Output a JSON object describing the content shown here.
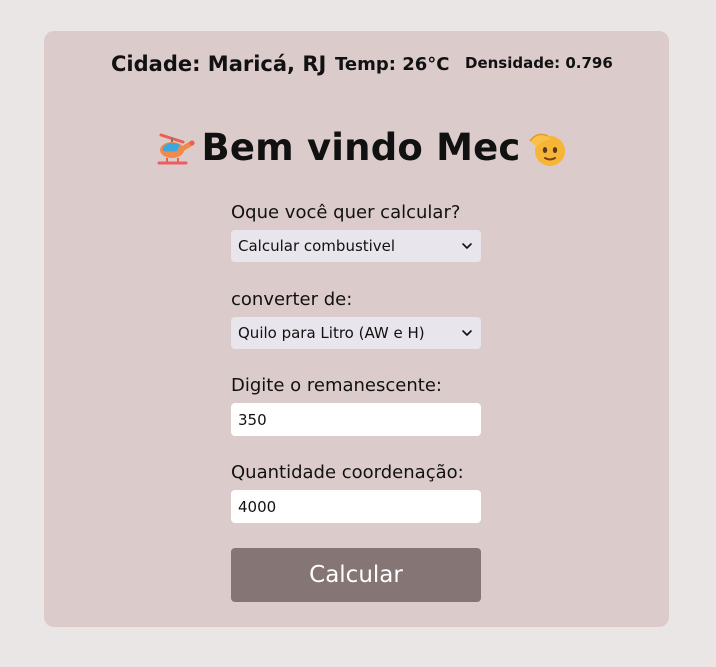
{
  "header": {
    "city": "Cidade: Maricá, RJ",
    "temperature": "Temp: 26°C",
    "density": "Densidade: 0.796"
  },
  "title": {
    "text": "Bem vindo Mec",
    "left_icon": "helicopter-icon",
    "right_icon": "saluting-face-icon"
  },
  "form": {
    "calc_label": "Oque você quer calcular?",
    "calc_select_value": "Calcular combustivel",
    "convert_label": "converter de:",
    "convert_select_value": "Quilo para Litro (AW e H)",
    "remaining_label": "Digite o remanescente:",
    "remaining_value": "350",
    "coordination_label": "Quantidade coordenação:",
    "coordination_value": "4000",
    "submit_label": "Calcular"
  },
  "colors": {
    "page_background": "#ebe6e6",
    "card_background": "#dbcbcb",
    "select_background": "#e8e6ec",
    "input_background": "#ffffff",
    "button_background": "#857574",
    "button_text": "#ffffff"
  }
}
